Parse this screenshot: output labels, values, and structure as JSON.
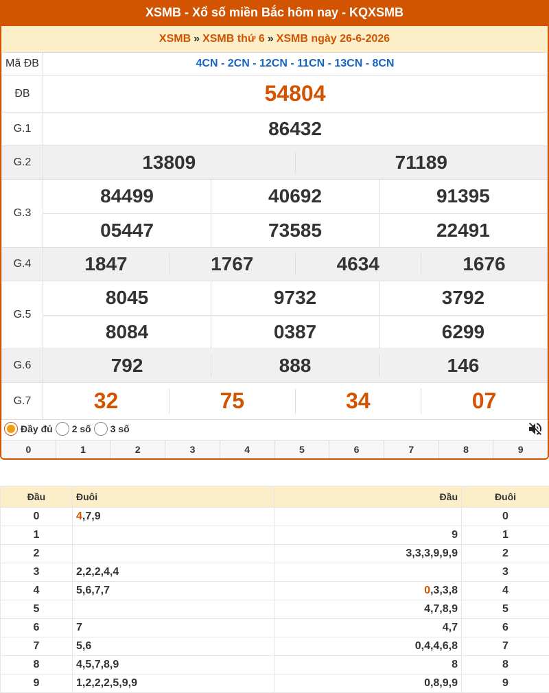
{
  "header": {
    "title": "XSMB - Xổ số miền Bắc hôm nay - KQXSMB"
  },
  "breadcrumb": {
    "item1": "XSMB",
    "item2": "XSMB thứ 6",
    "item3": "XSMB ngày 26-6-2026",
    "sep": "»"
  },
  "results": {
    "ma_db_label": "Mã ĐB",
    "ma_db_value": "4CN - 2CN - 12CN - 11CN - 13CN - 8CN",
    "db_label": "ĐB",
    "db": "54804",
    "g1_label": "G.1",
    "g1": "86432",
    "g2_label": "G.2",
    "g2": [
      "13809",
      "71189"
    ],
    "g3_label": "G.3",
    "g3": [
      "84499",
      "40692",
      "91395",
      "05447",
      "73585",
      "22491"
    ],
    "g4_label": "G.4",
    "g4": [
      "1847",
      "1767",
      "4634",
      "1676"
    ],
    "g5_label": "G.5",
    "g5": [
      "8045",
      "9732",
      "3792",
      "8084",
      "0387",
      "6299"
    ],
    "g6_label": "G.6",
    "g6": [
      "792",
      "888",
      "146"
    ],
    "g7_label": "G.7",
    "g7": [
      "32",
      "75",
      "34",
      "07"
    ]
  },
  "options": {
    "full": "Đầy đủ",
    "two": "2 số",
    "three": "3 số",
    "selected": "full"
  },
  "digits": [
    "0",
    "1",
    "2",
    "3",
    "4",
    "5",
    "6",
    "7",
    "8",
    "9"
  ],
  "loto": {
    "headers": {
      "dau": "Đầu",
      "duoi": "Đuôi",
      "dau2": "Đầu",
      "duoi2": "Đuôi"
    },
    "rows": [
      {
        "dau": "0",
        "duoi_hl": "4",
        "duoi": ",7,9",
        "dau2_hl": "",
        "dau2": "",
        "duoi2": "0"
      },
      {
        "dau": "1",
        "duoi_hl": "",
        "duoi": "",
        "dau2_hl": "",
        "dau2": "9",
        "duoi2": "1"
      },
      {
        "dau": "2",
        "duoi_hl": "",
        "duoi": "",
        "dau2_hl": "",
        "dau2": "3,3,3,9,9,9",
        "duoi2": "2"
      },
      {
        "dau": "3",
        "duoi_hl": "",
        "duoi": "2,2,2,4,4",
        "dau2_hl": "",
        "dau2": "",
        "duoi2": "3"
      },
      {
        "dau": "4",
        "duoi_hl": "",
        "duoi": "5,6,7,7",
        "dau2_hl": "0",
        "dau2": ",3,3,8",
        "duoi2": "4"
      },
      {
        "dau": "5",
        "duoi_hl": "",
        "duoi": "",
        "dau2_hl": "",
        "dau2": "4,7,8,9",
        "duoi2": "5"
      },
      {
        "dau": "6",
        "duoi_hl": "",
        "duoi": "7",
        "dau2_hl": "",
        "dau2": "4,7",
        "duoi2": "6"
      },
      {
        "dau": "7",
        "duoi_hl": "",
        "duoi": "5,6",
        "dau2_hl": "",
        "dau2": "0,4,4,6,8",
        "duoi2": "7"
      },
      {
        "dau": "8",
        "duoi_hl": "",
        "duoi": "4,5,7,8,9",
        "dau2_hl": "",
        "dau2": "8",
        "duoi2": "8"
      },
      {
        "dau": "9",
        "duoi_hl": "",
        "duoi": "1,2,2,2,5,9,9",
        "dau2_hl": "",
        "dau2": "0,8,9,9",
        "duoi2": "9"
      }
    ]
  },
  "colors": {
    "accent": "#d35400",
    "blue": "#1565c0",
    "cream": "#fbeec8"
  }
}
